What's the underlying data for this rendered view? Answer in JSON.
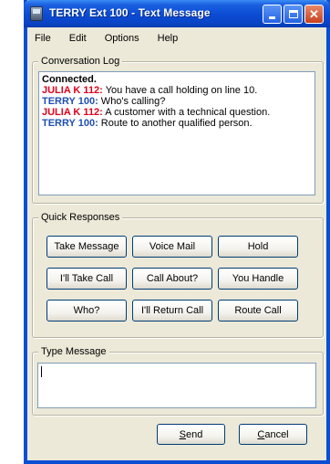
{
  "window": {
    "title": "TERRY Ext 100 - Text Message",
    "controls": {
      "minimize": "minimize",
      "maximize": "maximize",
      "close": "✕"
    }
  },
  "menu": [
    "File",
    "Edit",
    "Options",
    "Help"
  ],
  "conversation_log": {
    "label": "Conversation Log",
    "status": "Connected.",
    "messages": [
      {
        "speaker": "JULIA K 112:",
        "text": " You have a call holding on line 10.",
        "color": "#e0001a"
      },
      {
        "speaker": "TERRY 100:",
        "text": " Who's calling?",
        "color": "#1f4fb4"
      },
      {
        "speaker": "JULIA K 112:",
        "text": " A customer with a technical question.",
        "color": "#e0001a"
      },
      {
        "speaker": "TERRY 100:",
        "text": " Route to another qualified person.",
        "color": "#1f4fb4"
      }
    ]
  },
  "quick_responses": {
    "label": "Quick Responses",
    "buttons": [
      "Take Message",
      "Voice Mail",
      "Hold",
      "I'll Take Call",
      "Call About?",
      "You Handle",
      "Who?",
      "I'll Return Call",
      "Route Call"
    ]
  },
  "type_message": {
    "label": "Type Message",
    "value": ""
  },
  "actions": {
    "send_hotkey": "S",
    "send_rest": "end",
    "cancel_hotkey": "C",
    "cancel_rest": "ancel"
  }
}
